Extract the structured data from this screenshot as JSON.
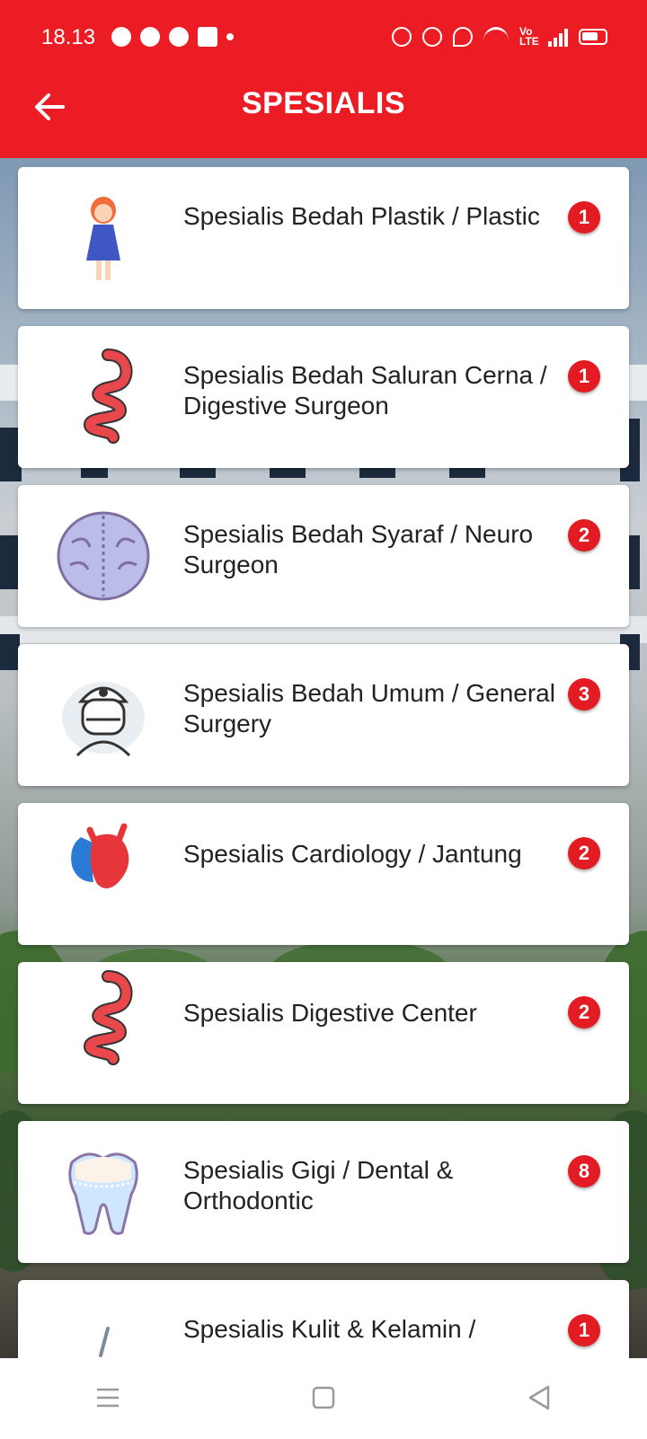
{
  "status_bar": {
    "time": "18.13",
    "network_label": "Vo LTE"
  },
  "header": {
    "title": "SPESIALIS",
    "back_icon": "arrow-left-icon",
    "background_color": "#ec1c24"
  },
  "specialties": [
    {
      "label": "Spesialis Bedah Plastik / Plastic",
      "count": "1",
      "icon": "woman-figure-icon"
    },
    {
      "label": "Spesialis Bedah Saluran Cerna / Digestive Surgeon",
      "count": "1",
      "icon": "stomach-icon"
    },
    {
      "label": "Spesialis Bedah Syaraf / Neuro Surgeon",
      "count": "2",
      "icon": "brain-icon"
    },
    {
      "label": "Spesialis Bedah Umum / General Surgery",
      "count": "3",
      "icon": "surgeon-icon"
    },
    {
      "label": "Spesialis Cardiology / Jantung",
      "count": "2",
      "icon": "heart-icon"
    },
    {
      "label": "Spesialis Digestive Center",
      "count": "2",
      "icon": "stomach-icon"
    },
    {
      "label": "Spesialis Gigi / Dental & Orthodontic",
      "count": "8",
      "icon": "tooth-icon"
    },
    {
      "label": "Spesialis Kulit & Kelamin /",
      "count": "1",
      "icon": "skin-icon"
    }
  ],
  "badge_color": "#e31b23",
  "nav": {
    "menu_icon": "menu-icon",
    "home_icon": "home-square-icon",
    "back_icon": "back-triangle-icon"
  }
}
